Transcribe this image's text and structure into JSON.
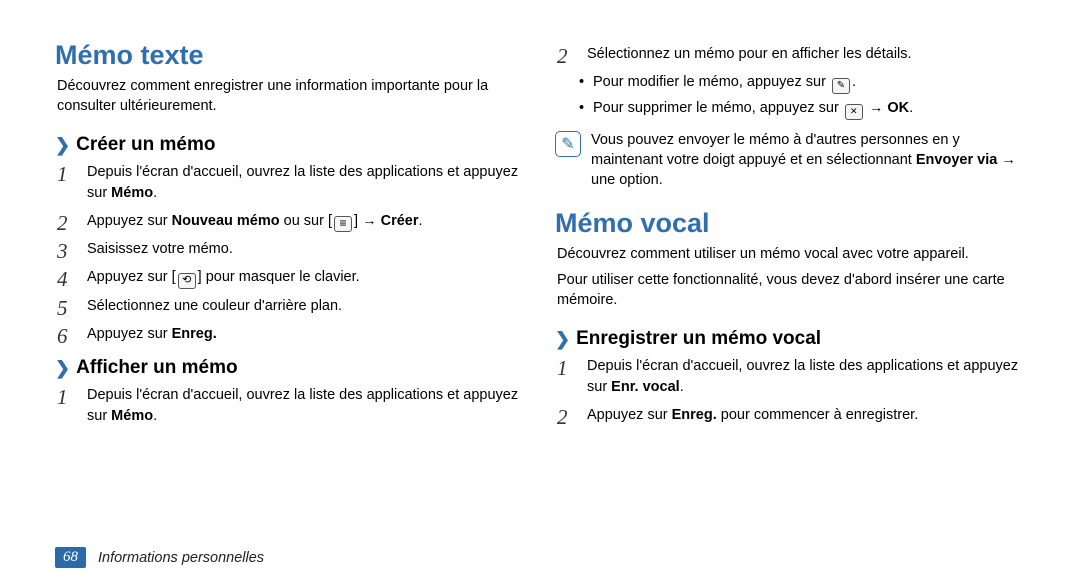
{
  "left": {
    "h1": "Mémo texte",
    "intro": "Découvrez comment enregistrer une information importante pour la consulter ultérieurement.",
    "sec1_title": "Créer un mémo",
    "s1_pre": "Depuis l'écran d'accueil, ouvrez la liste des applications et appuyez sur ",
    "s1_b": "Mémo",
    "s2_pre": "Appuyez sur ",
    "s2_b1": "Nouveau mémo",
    "s2_mid": " ou sur [",
    "s2_mid2": "] → ",
    "s2_b2": "Créer",
    "s3": "Saisissez votre mémo.",
    "s4_pre": "Appuyez sur [",
    "s4_post": "] pour masquer le clavier.",
    "s5": "Sélectionnez une couleur d'arrière plan.",
    "s6_pre": "Appuyez sur ",
    "s6_b": "Enreg.",
    "sec2_title": "Afficher un mémo",
    "a1_pre": "Depuis l'écran d'accueil, ouvrez la liste des applications et appuyez sur ",
    "a1_b": "Mémo"
  },
  "right": {
    "r2": "Sélectionnez un mémo pour en afficher les détails.",
    "b1_pre": "Pour modifier le mémo, appuyez sur ",
    "b2_pre": "Pour supprimer le mémo, appuyez sur ",
    "b2_mid": " → ",
    "b2_b": "OK",
    "note_pre": "Vous pouvez envoyer le mémo à d'autres personnes en y maintenant votre doigt appuyé et en sélectionnant ",
    "note_b": "Envoyer via",
    "note_post": " → une option.",
    "h1b": "Mémo vocal",
    "intro2a": "Découvrez comment utiliser un mémo vocal avec votre appareil.",
    "intro2b": "Pour utiliser cette fonctionnalité, vous devez d'abord insérer une carte mémoire.",
    "sec3_title": "Enregistrer un mémo vocal",
    "v1_pre": "Depuis l'écran d'accueil, ouvrez la liste des applications et appuyez sur ",
    "v1_b": "Enr. vocal",
    "v2_pre": "Appuyez sur ",
    "v2_b": "Enreg.",
    "v2_post": " pour commencer à enregistrer."
  },
  "footer": {
    "page": "68",
    "label": "Informations personnelles"
  }
}
